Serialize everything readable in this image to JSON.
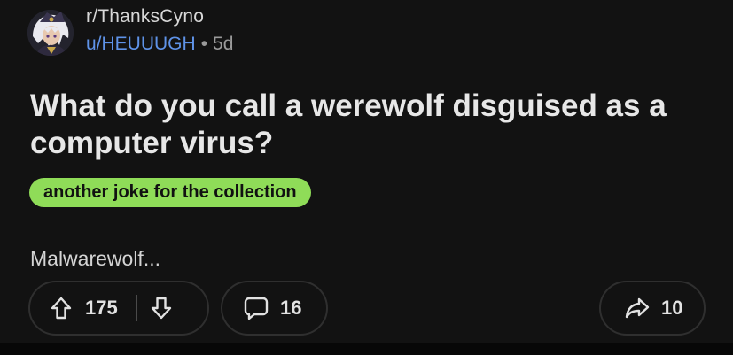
{
  "post": {
    "subreddit": "r/ThanksCyno",
    "author": "u/HEUUUGH",
    "separator": "•",
    "age": "5d",
    "title": "What do you call a werewolf disguised as a computer virus?",
    "flair": {
      "label": "another joke for the collection",
      "color": "#8fdc58"
    },
    "body": "Malwarewolf..."
  },
  "actions": {
    "upvotes": "175",
    "comments": "16",
    "shares": "10"
  },
  "icons": {
    "upvote": "upvote-arrow-icon",
    "downvote": "downvote-arrow-icon",
    "comment": "comment-bubble-icon",
    "share": "share-arrow-icon"
  },
  "colors": {
    "background": "#121212",
    "author_link": "#5f93e8",
    "meta_text": "#9a9a9a"
  }
}
